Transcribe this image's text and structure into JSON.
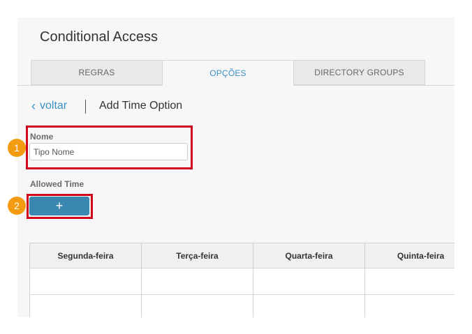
{
  "app": {
    "title": "Conditional Access"
  },
  "tabs": [
    {
      "label": "REGRAS",
      "active": false
    },
    {
      "label": "OPÇÕES",
      "active": true
    },
    {
      "label": "DIRECTORY GROUPS",
      "active": false
    }
  ],
  "nav": {
    "back_label": "voltar",
    "back_icon": "chevron-left-icon",
    "page_title": "Add Time Option"
  },
  "form": {
    "name_label": "Nome",
    "name_value": "Tipo Nome",
    "allowed_time_label": "Allowed Time",
    "add_button_label": "+"
  },
  "schedule_table": {
    "columns": [
      "Segunda-feira",
      "Terça-feira",
      "Quarta-feira",
      "Quinta-feira"
    ],
    "rows": [
      [
        "",
        "",
        "",
        ""
      ],
      [
        "",
        "",
        "",
        ""
      ]
    ]
  },
  "annotations": {
    "callouts": [
      "1",
      "2"
    ],
    "colors": {
      "highlight": "#d0021b",
      "badge": "#f39c12",
      "accent": "#3b8fc2"
    }
  }
}
